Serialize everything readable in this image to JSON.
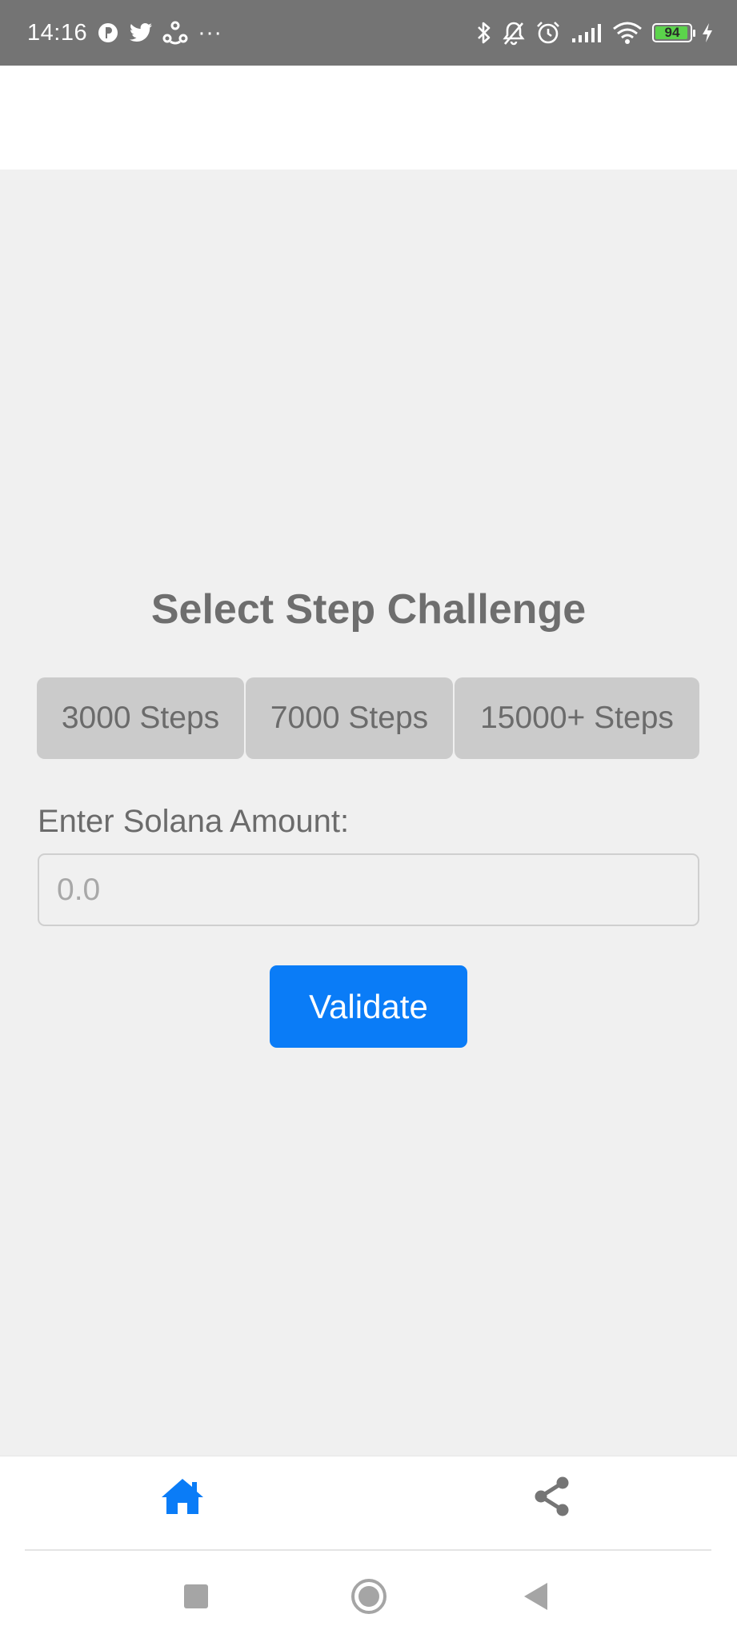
{
  "status_bar": {
    "time": "14:16",
    "overflow": "···",
    "battery_level": "94",
    "icons_left": [
      "p-app-icon",
      "twitter-icon",
      "share-app-icon"
    ],
    "icons_right": [
      "bluetooth-icon",
      "bell-off-icon",
      "alarm-icon",
      "signal-icon",
      "wifi-icon",
      "battery-icon",
      "charging-icon"
    ]
  },
  "main": {
    "title": "Select Step Challenge",
    "step_options": [
      "3000 Steps",
      "7000 Steps",
      "15000+ Steps"
    ],
    "amount_label": "Enter Solana Amount:",
    "amount_placeholder": "0.0",
    "amount_value": "",
    "validate_label": "Validate"
  },
  "tab_bar": {
    "items": [
      {
        "icon": "home-icon",
        "active": true
      },
      {
        "icon": "share-icon",
        "active": false
      }
    ]
  },
  "colors": {
    "status_bar_bg": "#747474",
    "content_bg": "#f0f0f0",
    "option_bg": "#cbcbcb",
    "text_gray": "#6b6b6b",
    "accent_blue": "#0a7cf7",
    "battery_green": "#5bd34b"
  }
}
